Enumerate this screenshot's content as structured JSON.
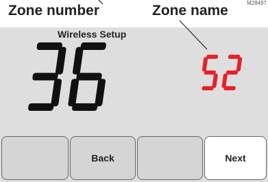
{
  "callouts": {
    "zone_number_label": "Zone number",
    "zone_name_label": "Zone name",
    "figure_code": "M28497"
  },
  "screen": {
    "title": "Wireless Setup",
    "zone_number": "36",
    "zone_name": "52",
    "zone_name_color": "#e8202a",
    "digit_color": "#111111"
  },
  "buttons": [
    {
      "label": ""
    },
    {
      "label": "Back"
    },
    {
      "label": ""
    },
    {
      "label": "Next"
    }
  ]
}
